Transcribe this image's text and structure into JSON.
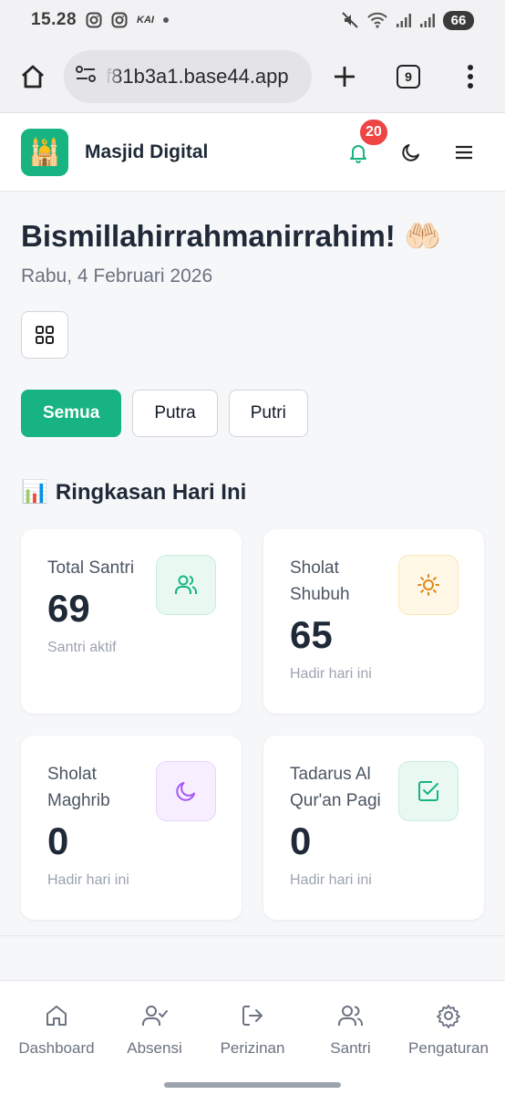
{
  "status_bar": {
    "time": "15.28",
    "carrier_badge": "KAI",
    "battery": "66",
    "icons": [
      "instagram-icon",
      "instagram-icon",
      "mute-icon",
      "wifi-icon",
      "signal-icon",
      "signal-icon"
    ]
  },
  "browser": {
    "url": "f81b3a1.base44.app",
    "tab_count": "9"
  },
  "header": {
    "app_title": "Masjid Digital",
    "logo_glyph": "🕌",
    "notification_count": "20",
    "accent": "#17b482"
  },
  "main": {
    "greeting": "Bismillahirrahmanirrahim! 🤲🏻",
    "date": "Rabu, 4 Februari 2026",
    "filters": [
      {
        "label": "Semua",
        "active": true
      },
      {
        "label": "Putra",
        "active": false
      },
      {
        "label": "Putri",
        "active": false
      }
    ],
    "section_title": "Ringkasan Hari Ini",
    "section_icon": "📊",
    "cards": [
      {
        "label": "Total Santri",
        "value": "69",
        "sub": "Santri aktif",
        "icon": "users-icon",
        "color": "#17b482"
      },
      {
        "label": "Sholat Shubuh",
        "value": "65",
        "sub": "Hadir hari ini",
        "icon": "sun-icon",
        "color": "#f59e0b"
      },
      {
        "label": "Sholat Maghrib",
        "value": "0",
        "sub": "Hadir hari ini",
        "icon": "moon-icon",
        "color": "#a855f7"
      },
      {
        "label": "Tadarus Al Qur'an Pagi",
        "value": "0",
        "sub": "Hadir hari ini",
        "icon": "checkbox-icon",
        "color": "#17b482"
      }
    ]
  },
  "bottom_nav": [
    {
      "label": "Dashboard",
      "icon": "home-icon"
    },
    {
      "label": "Absensi",
      "icon": "user-check-icon"
    },
    {
      "label": "Perizinan",
      "icon": "logout-icon"
    },
    {
      "label": "Santri",
      "icon": "users-icon"
    },
    {
      "label": "Pengaturan",
      "icon": "gear-icon"
    }
  ]
}
